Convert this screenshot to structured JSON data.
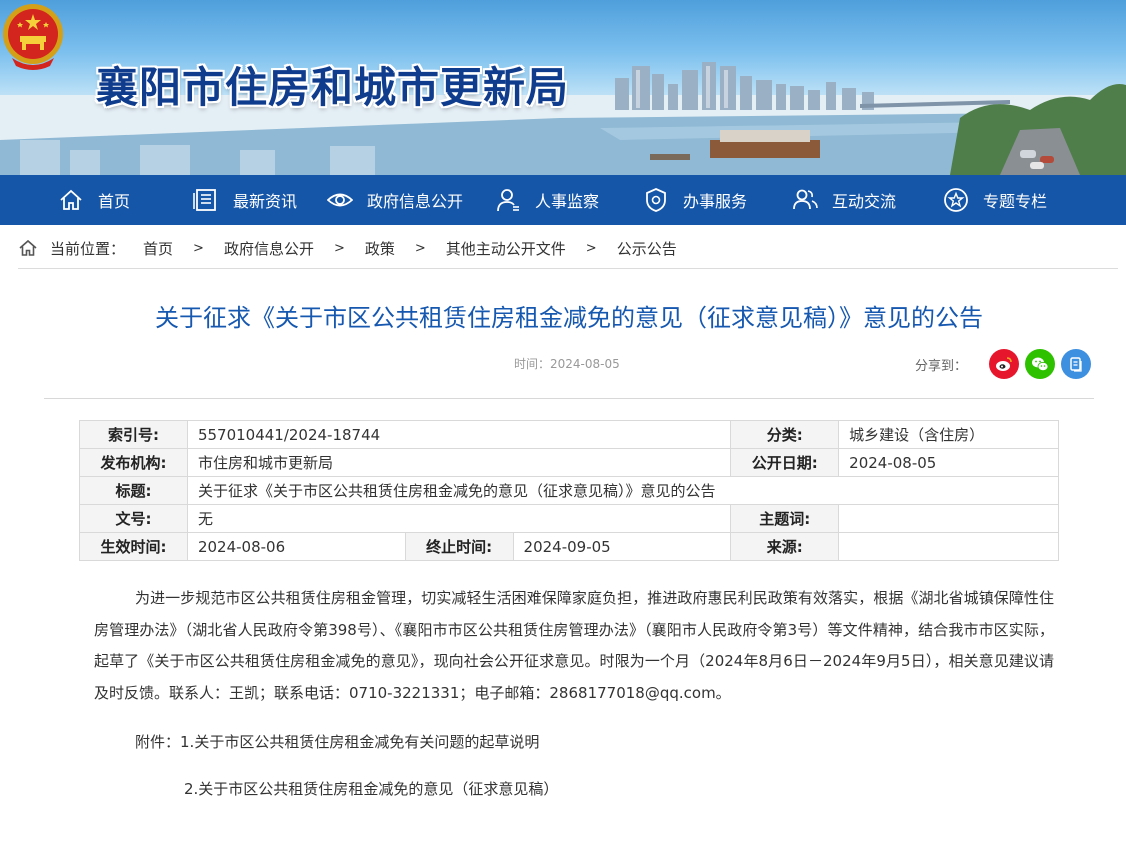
{
  "site": {
    "title": "襄阳市住房和城市更新局",
    "emblem_icon": "national-emblem-icon"
  },
  "nav": {
    "items": [
      {
        "label": "首页",
        "icon": "home-icon"
      },
      {
        "label": "最新资讯",
        "icon": "news-icon"
      },
      {
        "label": "政府信息公开",
        "icon": "eye-icon"
      },
      {
        "label": "人事监察",
        "icon": "person-icon"
      },
      {
        "label": "办事服务",
        "icon": "shield-icon"
      },
      {
        "label": "互动交流",
        "icon": "people-icon"
      },
      {
        "label": "专题专栏",
        "icon": "star-icon"
      }
    ]
  },
  "breadcrumb": {
    "prefix": "当前位置：",
    "separator": ">",
    "items": [
      "首页",
      "政府信息公开",
      "政策",
      "其他主动公开文件",
      "公示公告"
    ]
  },
  "article": {
    "title": "关于征求《关于市区公共租赁住房租金减免的意见（征求意见稿）》意见的公告",
    "time": "时间：2024-08-05",
    "share_label": "分享到："
  },
  "share": {
    "weibo_icon": "weibo-icon",
    "wechat_icon": "wechat-icon",
    "copy_icon": "copy-icon",
    "colors": {
      "weibo": "#e6162d",
      "wechat": "#2dc100",
      "copy": "#3d8fe0"
    }
  },
  "info": {
    "index_label": "索引号:",
    "index_value": "557010441/2024-18744",
    "category_label": "分类:",
    "category_value": "城乡建设（含住房）",
    "publisher_label": "发布机构:",
    "publisher_value": "市住房和城市更新局",
    "publish_date_label": "公开日期:",
    "publish_date_value": "2024-08-05",
    "title_label": "标题:",
    "title_value": "关于征求《关于市区公共租赁住房租金减免的意见（征求意见稿）》意见的公告",
    "doc_no_label": "文号:",
    "doc_no_value": "无",
    "subject_label": "主题词:",
    "subject_value": "",
    "effective_label": "生效时间:",
    "effective_value": "2024-08-06",
    "end_label": "终止时间:",
    "end_value": "2024-09-05",
    "source_label": "来源:",
    "source_value": ""
  },
  "body": {
    "paragraph": "为进一步规范市区公共租赁住房租金管理，切实减轻生活困难保障家庭负担，推进政府惠民利民政策有效落实，根据《湖北省城镇保障性住房管理办法》（湖北省人民政府令第398号）、《襄阳市市区公共租赁住房管理办法》（襄阳市人民政府令第3号）等文件精神，结合我市市区实际，起草了《关于市区公共租赁住房租金减免的意见》，现向社会公开征求意见。时限为一个月（2024年8月6日－2024年9月5日），相关意见建议请及时反馈。联系人：王凯；联系电话：0710-3221331；电子邮箱：2868177018@qq.com。",
    "attach_prefix": "附件：",
    "attach_1": "1.关于市区公共租赁住房租金减免有关问题的起草说明",
    "attach_2": "2.关于市区公共租赁住房租金减免的意见（征求意见稿）"
  },
  "colors": {
    "nav_bg": "#1656a8",
    "title_blue": "#1658b0",
    "site_title": "#0f3c8c"
  }
}
